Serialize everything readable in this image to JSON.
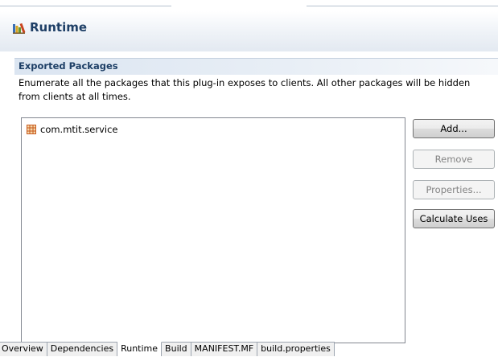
{
  "header": {
    "title": "Runtime",
    "icon": "runtime-books-icon"
  },
  "exported_packages": {
    "section_title": "Exported Packages",
    "description": "Enumerate all the packages that this plug-in exposes to clients.  All other packages will be hidden from clients at all times.",
    "packages": [
      {
        "label": "com.mtit.service",
        "icon": "package-icon"
      }
    ],
    "buttons": {
      "add": "Add...",
      "remove": "Remove",
      "properties": "Properties...",
      "calculate_uses": "Calculate Uses"
    }
  },
  "tabs": [
    {
      "label": "Overview"
    },
    {
      "label": "Dependencies"
    },
    {
      "label": "Runtime",
      "active": true
    },
    {
      "label": "Build"
    },
    {
      "label": "MANIFEST.MF"
    },
    {
      "label": "build.properties"
    }
  ],
  "colors": {
    "title": "#1e3f66",
    "package_icon": "#c85a1e",
    "disabled_text": "#838383"
  }
}
